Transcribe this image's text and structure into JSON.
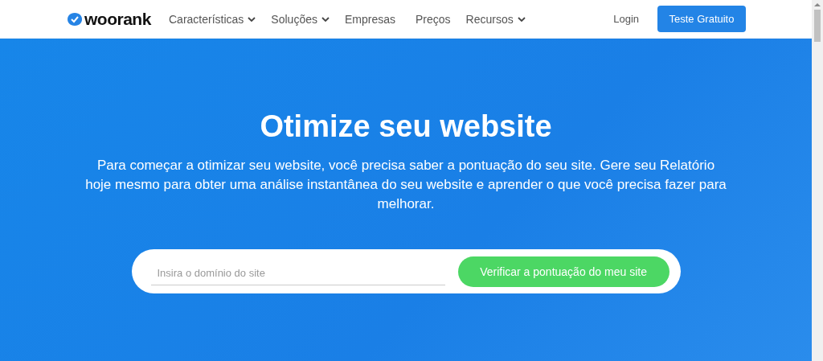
{
  "header": {
    "logo": "woorank",
    "nav": [
      {
        "label": "Características",
        "has_menu": true
      },
      {
        "label": "Soluções",
        "has_menu": true
      },
      {
        "label": "Empresas",
        "has_menu": false
      },
      {
        "label": "Preços",
        "has_menu": false
      },
      {
        "label": "Recursos",
        "has_menu": true
      }
    ],
    "login": "Login",
    "cta": "Teste Gratuito"
  },
  "hero": {
    "title": "Otimize seu website",
    "text": "Para começar a otimizar seu website, você precisa saber a pontuação do seu site. Gere seu Relatório hoje mesmo para obter uma análise instantânea do seu website e aprender o que você precisa fazer para melhorar.",
    "search": {
      "placeholder": "Insira o domínio do site"
    },
    "button": "Verificar a pontuação do meu site"
  }
}
